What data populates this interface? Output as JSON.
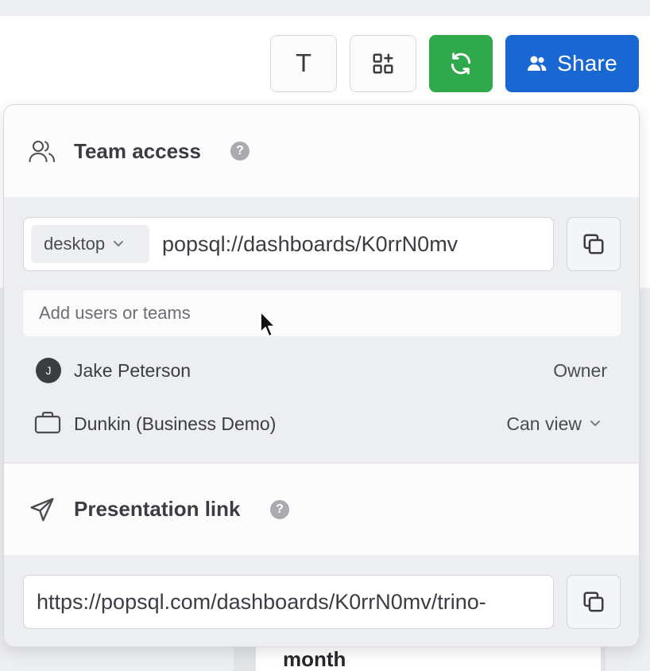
{
  "toolbar": {
    "text_button_glyph": "T",
    "share_label": "Share",
    "refresh_color": "#2fa94b",
    "share_color": "#1967d2"
  },
  "team_access": {
    "title": "Team access",
    "help_glyph": "?",
    "environment": "desktop",
    "url": "popsql://dashboards/K0rrN0mv",
    "add_placeholder": "Add users or teams",
    "members": [
      {
        "avatar_initial": "J",
        "name": "Jake Peterson",
        "role": "Owner"
      },
      {
        "name": "Dunkin (Business Demo)",
        "role": "Can view"
      }
    ]
  },
  "presentation_link": {
    "title": "Presentation link",
    "help_glyph": "?",
    "url": "https://popsql.com/dashboards/K0rrN0mv/trino-"
  },
  "background": {
    "card_heading": "month"
  }
}
